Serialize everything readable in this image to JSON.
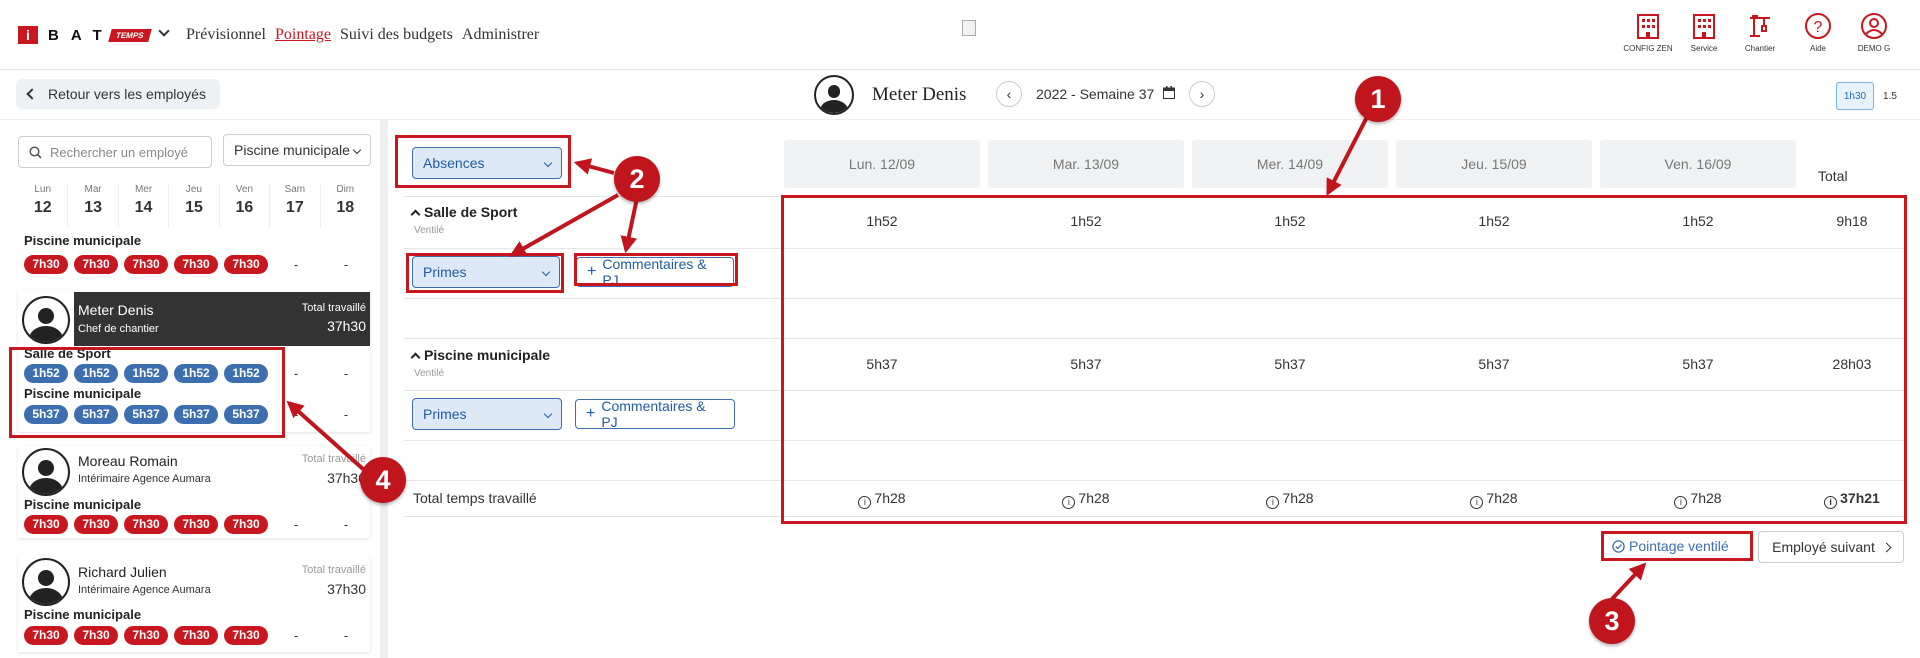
{
  "brand": {
    "letter": "i",
    "name": "BAT",
    "badge": "TEMPS"
  },
  "nav": [
    "Prévisionnel",
    "Pointage",
    "Suivi des budgets",
    "Administrer"
  ],
  "nav_active": "Pointage",
  "header_icons": [
    {
      "label": "CONFIG ZEN",
      "icon": "building-icon"
    },
    {
      "label": "Service",
      "icon": "building-icon"
    },
    {
      "label": "Chantier",
      "icon": "crane-icon"
    },
    {
      "label": "Aide",
      "icon": "help-icon"
    },
    {
      "label": "DEMO G",
      "icon": "user-icon"
    }
  ],
  "back_label": "Retour vers les employés",
  "employee_name": "Meter Denis",
  "week": "2022 - Semaine 37",
  "zoom": {
    "a": "1h30",
    "b": "1.5"
  },
  "left": {
    "search_placeholder": "Rechercher un employé",
    "site_filter": "Piscine municipale",
    "days": [
      {
        "d": "Lun",
        "n": "12"
      },
      {
        "d": "Mar",
        "n": "13"
      },
      {
        "d": "Mer",
        "n": "14"
      },
      {
        "d": "Jeu",
        "n": "15"
      },
      {
        "d": "Ven",
        "n": "16"
      },
      {
        "d": "Sam",
        "n": "17"
      },
      {
        "d": "Dim",
        "n": "18"
      }
    ],
    "prev_site": "Piscine municipale",
    "pill_red": "7h30",
    "dash": "-",
    "total_label": "Total travaillé",
    "employees": [
      {
        "name": "Meter Denis",
        "role": "Chef de chantier",
        "total": "37h30"
      },
      {
        "name": "Moreau Romain",
        "role": "Intérimaire Agence Aumara",
        "total": "37h30"
      },
      {
        "name": "Richard Julien",
        "role": "Intérimaire Agence Aumara",
        "total": "37h30"
      }
    ],
    "selected_sites": [
      {
        "name": "Salle de Sport",
        "value": "1h52"
      },
      {
        "name": "Piscine municipale",
        "value": "5h37"
      }
    ],
    "other_site": "Piscine municipale"
  },
  "grid": {
    "absences": "Absences",
    "days": [
      "Lun. 12/09",
      "Mar. 13/09",
      "Mer. 14/09",
      "Jeu. 15/09",
      "Ven. 16/09"
    ],
    "total_header": "Total",
    "sections": [
      {
        "title": "Salle de Sport",
        "sub": "Ventilé",
        "values": [
          "1h52",
          "1h52",
          "1h52",
          "1h52",
          "1h52"
        ],
        "total": "9h18",
        "primes": "Primes",
        "comments": "Commentaires & PJ"
      },
      {
        "title": "Piscine municipale",
        "sub": "Ventilé",
        "values": [
          "5h37",
          "5h37",
          "5h37",
          "5h37",
          "5h37"
        ],
        "total": "28h03",
        "primes": "Primes",
        "comments": "Commentaires & PJ"
      }
    ],
    "total_row": {
      "label": "Total temps travaillé",
      "values": [
        "7h28",
        "7h28",
        "7h28",
        "7h28",
        "7h28"
      ],
      "total": "37h21"
    }
  },
  "status_label": "Pointage ventilé",
  "next_label": "Employé suivant",
  "markers": [
    "1",
    "2",
    "3",
    "4"
  ],
  "colors": {
    "brand_red": "#c8171e",
    "blue": "#3d6fb0",
    "dark_card": "#333333",
    "annotation_red": "#c0151c"
  }
}
